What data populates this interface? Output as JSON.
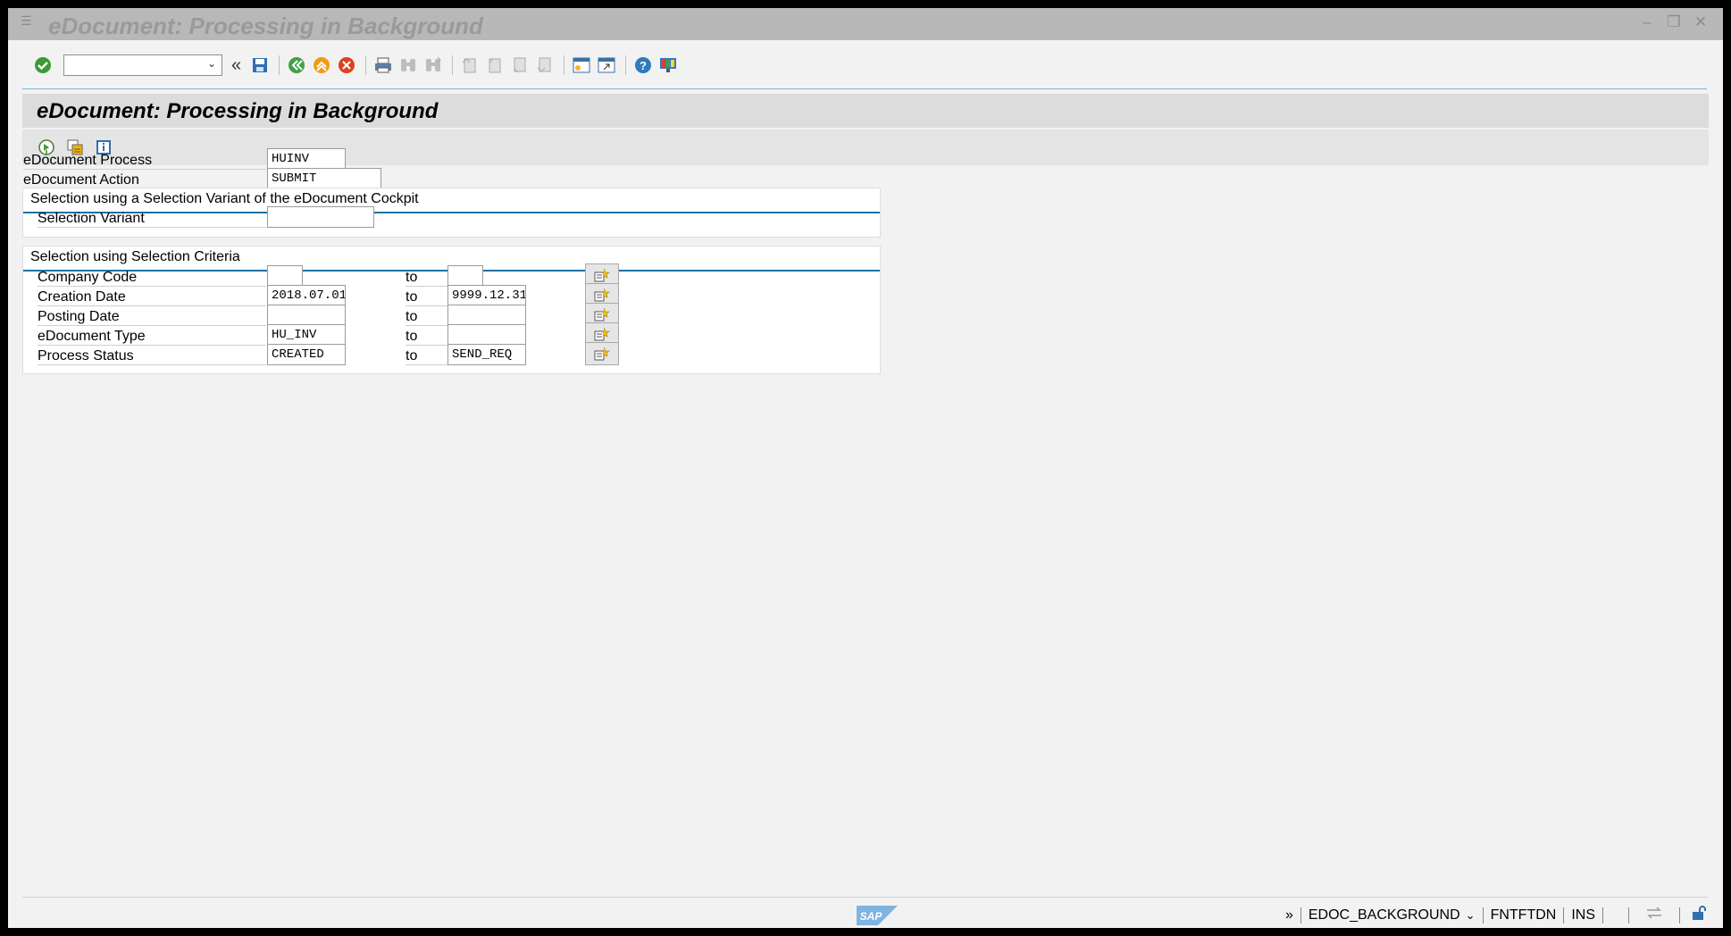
{
  "window": {
    "title": "eDocument: Processing in Background"
  },
  "toolbar": {
    "command_value": "",
    "icons": [
      "enter-icon",
      "save-icon",
      "back-icon",
      "exit-icon",
      "cancel-icon",
      "print-icon",
      "find-icon",
      "find-next-icon",
      "first-page-icon",
      "previous-page-icon",
      "next-page-icon",
      "last-page-icon",
      "create-session-icon",
      "shortcut-icon",
      "help-icon",
      "customize-layout-icon"
    ]
  },
  "page": {
    "title": "eDocument: Processing in Background"
  },
  "app_toolbar": {
    "icons": [
      "execute-icon",
      "get-variant-icon",
      "information-icon"
    ]
  },
  "form": {
    "process_label": "eDocument Process",
    "process_value": "HUINV",
    "action_label": "eDocument Action",
    "action_value": "SUBMIT",
    "variant_group_title": "Selection using a Selection Variant of the eDocument Cockpit",
    "variant_label": "Selection Variant",
    "variant_value": "",
    "criteria_group_title": "Selection using Selection Criteria",
    "to_label": "to",
    "rows": [
      {
        "label": "Company Code",
        "from": "",
        "to": ""
      },
      {
        "label": "Creation Date",
        "from": "2018.07.01",
        "to": "9999.12.31"
      },
      {
        "label": "Posting Date",
        "from": "",
        "to": ""
      },
      {
        "label": "eDocument Type",
        "from": "HU_INV",
        "to": ""
      },
      {
        "label": "Process Status",
        "from": "CREATED",
        "to": "SEND_REQ"
      }
    ]
  },
  "status": {
    "expand": "»",
    "transaction": "EDOC_BACKGROUND",
    "user": "FNTFTDN",
    "mode": "INS",
    "sap_logo_text": "SAP"
  },
  "colors": {
    "accent": "#1f6fa3",
    "title_bar": "#b8b8b8",
    "page_title_bar": "#dcdcdc"
  }
}
